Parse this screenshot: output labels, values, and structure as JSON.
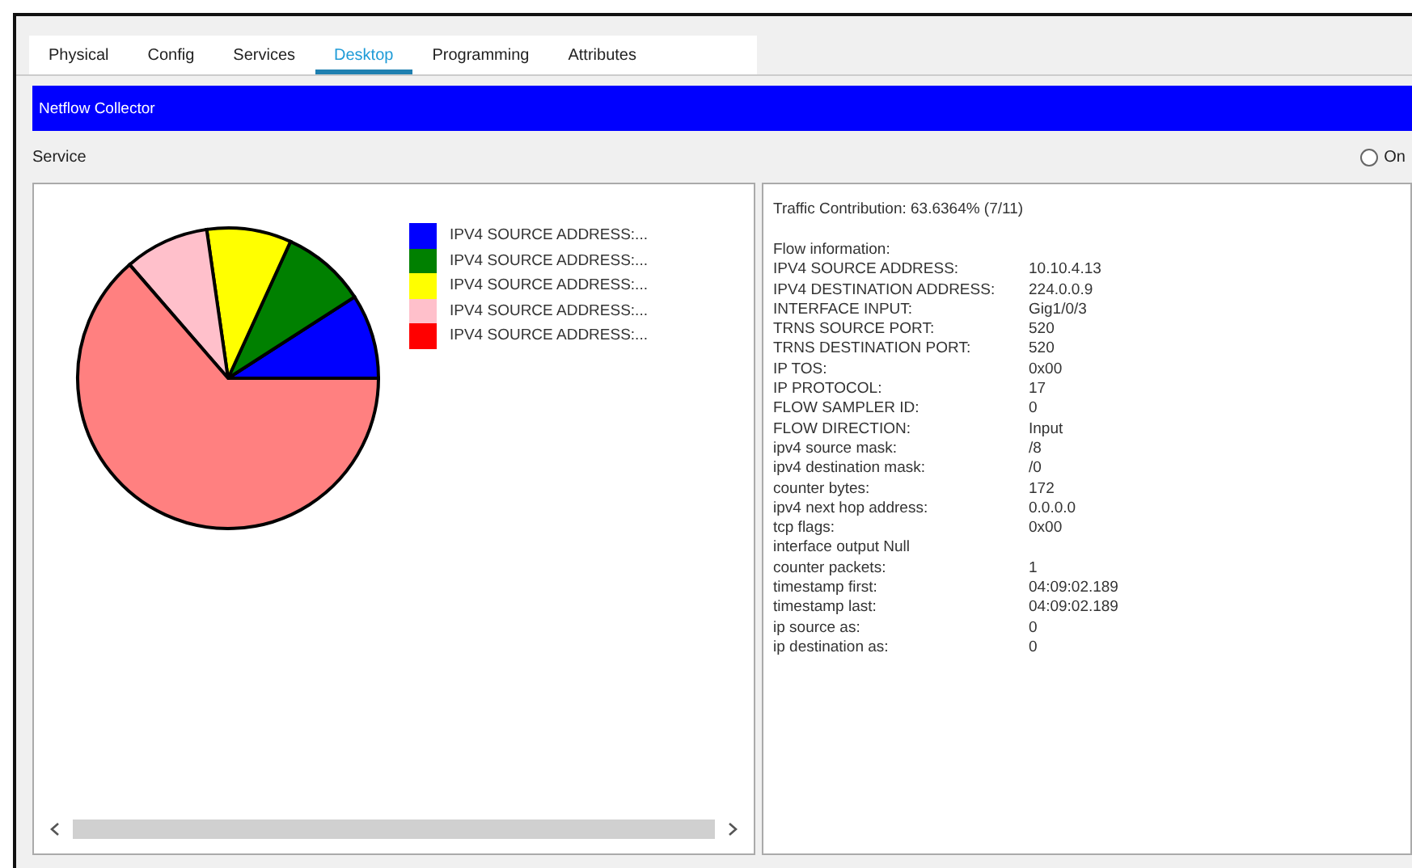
{
  "tabs": [
    {
      "label": "Physical",
      "selected": false
    },
    {
      "label": "Config",
      "selected": false
    },
    {
      "label": "Services",
      "selected": false
    },
    {
      "label": "Desktop",
      "selected": true
    },
    {
      "label": "Programming",
      "selected": false
    },
    {
      "label": "Attributes",
      "selected": false
    }
  ],
  "header": {
    "title": "Netflow Collector"
  },
  "service": {
    "label": "Service",
    "on_label": "On",
    "on": false
  },
  "chart": {
    "chart_data": {
      "type": "pie",
      "categories": [
        "IPV4 SOURCE ADDRESS:...",
        "IPV4 SOURCE ADDRESS:...",
        "IPV4 SOURCE ADDRESS:...",
        "IPV4 SOURCE ADDRESS:...",
        "IPV4 SOURCE ADDRESS:..."
      ],
      "values": [
        9.0909,
        9.0909,
        9.0909,
        9.0909,
        63.6364
      ]
    },
    "slices": [
      {
        "color": "#0000ff"
      },
      {
        "color": "#008000"
      },
      {
        "color": "#ffff00"
      },
      {
        "color": "#ffc0cb"
      },
      {
        "color": "#ff8080"
      }
    ],
    "legend": [
      {
        "color": "#0000ff"
      },
      {
        "color": "#008000"
      },
      {
        "color": "#ffff00"
      },
      {
        "color": "#ffc0cb"
      },
      {
        "color": "#ff0000"
      }
    ]
  },
  "details": {
    "contribution": "Traffic Contribution: 63.6364% (7/11)",
    "heading": "Flow information:",
    "rows": [
      {
        "label": "IPV4 SOURCE ADDRESS:",
        "value": "10.10.4.13"
      },
      {
        "label": "IPV4 DESTINATION ADDRESS:",
        "value": "224.0.0.9"
      },
      {
        "label": "INTERFACE INPUT:",
        "value": "Gig1/0/3"
      },
      {
        "label": "TRNS SOURCE PORT:",
        "value": "520"
      },
      {
        "label": "TRNS DESTINATION PORT:",
        "value": "520"
      },
      {
        "label": "IP TOS:",
        "value": "0x00"
      },
      {
        "label": "IP PROTOCOL:",
        "value": "17"
      },
      {
        "label": "FLOW SAMPLER ID:",
        "value": "0"
      },
      {
        "label": "FLOW DIRECTION:",
        "value": "Input"
      },
      {
        "label": "ipv4 source mask:",
        "value": "/8"
      },
      {
        "label": "ipv4 destination mask:",
        "value": "/0"
      },
      {
        "label": "counter bytes:",
        "value": "172"
      },
      {
        "label": "ipv4 next hop address:",
        "value": "0.0.0.0"
      },
      {
        "label": "tcp flags:",
        "value": "0x00"
      },
      {
        "label": "interface output Null"
      },
      {
        "label": "counter packets:",
        "value": "1"
      },
      {
        "label": "timestamp first:",
        "value": "04:09:02.189"
      },
      {
        "label": "timestamp last:",
        "value": "04:09:02.189"
      },
      {
        "label": "ip source as:",
        "value": "0"
      },
      {
        "label": "ip destination as:",
        "value": "0"
      }
    ]
  }
}
